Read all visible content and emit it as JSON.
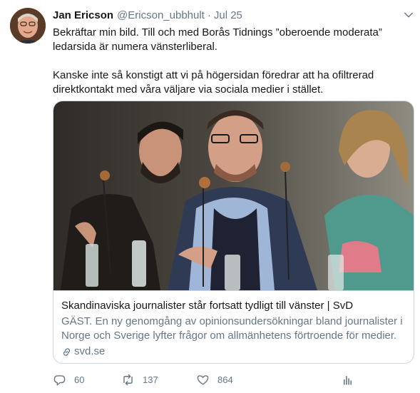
{
  "tweet": {
    "author_name": "Jan Ericson",
    "author_handle": "@Ericson_ubbhult",
    "separator": "·",
    "date": "Jul 25",
    "text": [
      "Bekräftar min bild. Till och med Borås Tidnings ”oberoende moderata” ledarsida är numera vänsterliberal.",
      "Kanske inte så konstigt att vi på högersidan föredrar att ha ofiltrerad direktkontakt med våra väljare via sociala medier i stället."
    ]
  },
  "card": {
    "title": "Skandinaviska journalister står fortsatt tydligt till vänster | SvD",
    "description": "GÄST. En ny genomgång av opinionsundersökningar bland journalister i Norge och Sverige lyfter frågor om allmänhetens förtroende för medier.",
    "domain": "svd.se"
  },
  "actions": {
    "reply_count": "60",
    "retweet_count": "137",
    "like_count": "864"
  },
  "colors": {
    "text": "#14171a",
    "secondary": "#657786",
    "border": "#ccd6dd"
  },
  "icons": [
    "avatar",
    "chevron-down-icon",
    "link-icon",
    "reply-icon",
    "retweet-icon",
    "like-icon",
    "analytics-icon"
  ]
}
